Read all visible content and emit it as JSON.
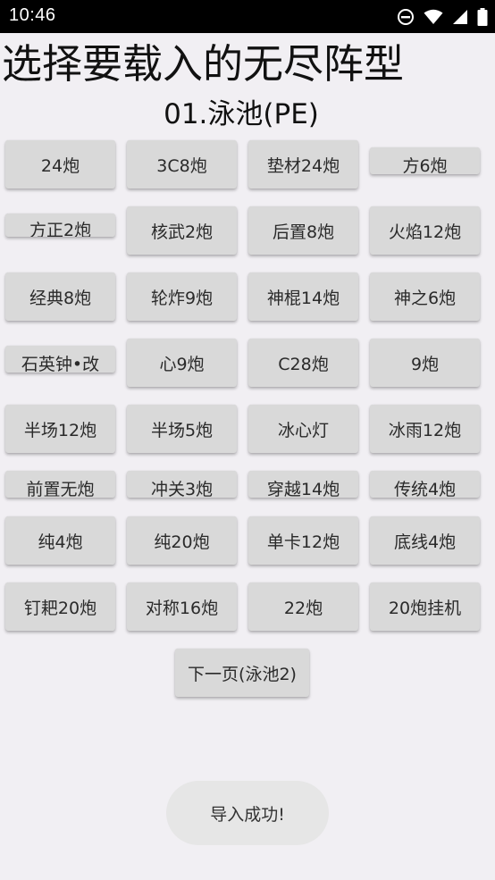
{
  "status_bar": {
    "time": "10:46",
    "icons": [
      "do-not-disturb-icon",
      "wifi-icon",
      "signal-icon",
      "battery-icon"
    ]
  },
  "page": {
    "title": "选择要载入的无尽阵型",
    "subtitle": "01.泳池(PE)"
  },
  "buttons": [
    "24炮",
    "3C8炮",
    "垫材24炮",
    "方6炮",
    "方正2炮",
    "核武2炮",
    "后置8炮",
    "火焰12炮",
    "经典8炮",
    "轮炸9炮",
    "神棍14炮",
    "神之6炮",
    "石英钟•改",
    "心9炮",
    "C28炮",
    "9炮",
    "半场12炮",
    "半场5炮",
    "冰心灯",
    "冰雨12炮",
    "前置无炮",
    "冲关3炮",
    "穿越14炮",
    "传统4炮",
    "纯4炮",
    "纯20炮",
    "单卡12炮",
    "底线4炮",
    "钉耙20炮",
    "对称16炮",
    "22炮",
    "20炮挂机"
  ],
  "next_page": {
    "label": "下一页(泳池2)"
  },
  "toast": {
    "message": "导入成功!"
  }
}
